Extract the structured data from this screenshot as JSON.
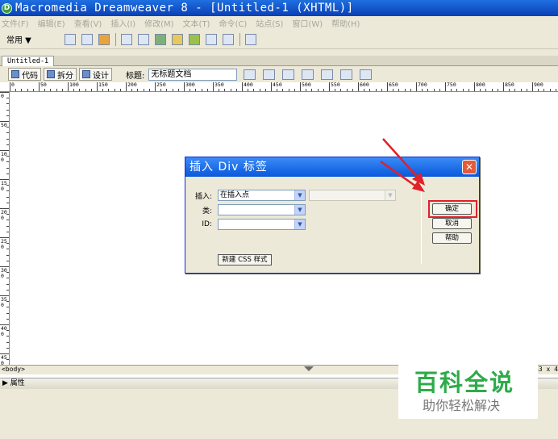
{
  "app": {
    "window_title": "Macromedia Dreamweaver 8 - [Untitled-1 (XHTML)]",
    "logo_glyph": "D"
  },
  "menu": {
    "items": [
      "文件(F)",
      "编辑(E)",
      "查看(V)",
      "插入(I)",
      "修改(M)",
      "文本(T)",
      "命令(C)",
      "站点(S)",
      "窗口(W)",
      "帮助(H)"
    ]
  },
  "insert_toolbar": {
    "category": "常用 ▼",
    "icons": [
      "hyperlink-icon",
      "email-link-icon",
      "named-anchor-icon",
      "table-icon",
      "layer-icon",
      "image-icon",
      "media-icon",
      "date-icon",
      "comment-icon",
      "template-icon",
      "tag-chooser-icon"
    ]
  },
  "document": {
    "tab_label": "Untitled-1",
    "view_code": "代码",
    "view_split": "拆分",
    "view_design": "设计",
    "title_label": "标题:",
    "title_value": "无标题文档",
    "toolbar_icons": [
      "browser-check-icon",
      "validate-icon",
      "file-management-icon",
      "preview-icon",
      "refresh-icon",
      "view-options-icon",
      "visual-aids-icon"
    ]
  },
  "ruler": {
    "h_labels": [
      "0",
      "50",
      "100",
      "150",
      "200",
      "250",
      "300",
      "350",
      "400",
      "450",
      "500",
      "550",
      "600",
      "650",
      "700",
      "750",
      "800",
      "850",
      "900"
    ],
    "v_labels": [
      "0",
      "50",
      "100",
      "150",
      "200",
      "250",
      "300",
      "350",
      "400",
      "450"
    ]
  },
  "status": {
    "tag_selector": "<body>",
    "window_size": "43 x 4"
  },
  "properties": {
    "label": "▶ 属性"
  },
  "dialog": {
    "title": "插入 Div 标签",
    "close_glyph": "✕",
    "insert_label": "插入:",
    "insert_value": "在插入点",
    "class_label": "类:",
    "class_value": "",
    "id_label": "ID:",
    "id_value": "",
    "new_css_button": "新建 CSS 样式",
    "ok_button": "确定",
    "cancel_button": "取消",
    "help_button": "帮助"
  },
  "watermark": {
    "main": "百科全说",
    "sub": "助你轻松解决"
  },
  "colors": {
    "titlebar": "#0a3fb6",
    "dialog_title": "#0858dc",
    "highlight": "#e0202a",
    "watermark": "#2dab4a"
  }
}
